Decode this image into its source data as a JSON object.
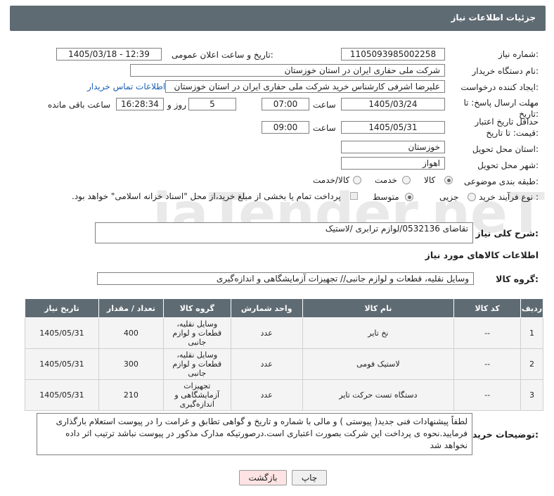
{
  "header": {
    "title": "جزئیات اطلاعات نیاز"
  },
  "fields": {
    "need_number_label": "شماره نیاز:",
    "need_number": "1105093985002258",
    "announce_label": "تاریخ و ساعت اعلان عمومی:",
    "announce_value": "1405/03/18 - 12:39",
    "buyer_org_label": "نام دستگاه خریدار:",
    "buyer_org": "شرکت ملی حفاری ایران در استان خوزستان",
    "requester_label": "ایجاد کننده درخواست:",
    "requester": "علیرضا اشرفی کارشناس خرید شرکت ملی حفاری ایران در استان خوزستان",
    "contact_link": "اطلاعات تماس خریدار",
    "deadline_label": "مهلت ارسال پاسخ: تا تاریخ:",
    "deadline_date": "1405/03/24",
    "time_label": "ساعت",
    "deadline_time": "07:00",
    "days_value": "5",
    "days_label": "روز و",
    "remaining_time": "16:28:34",
    "remaining_label": "ساعت باقی مانده",
    "validity_label": "حداقل تاریخ اعتبار قیمت: تا تاریخ:",
    "validity_date": "1405/05/31",
    "validity_time": "09:00",
    "province_label": "استان محل تحویل:",
    "province": "خوزستان",
    "city_label": "شهر محل تحویل:",
    "city": "اهواز",
    "category_label": "طبقه بندی موضوعی:",
    "category_options": [
      "کالا",
      "خدمت",
      "کالا/خدمت"
    ],
    "process_label": "نوع فرآیند خرید :",
    "process_options": [
      "جزیی",
      "متوسط"
    ],
    "payment_note": "پرداخت تمام یا بخشی از مبلغ خرید،از محل \"اسناد خزانه اسلامی\" خواهد بود."
  },
  "description": {
    "label": "شرح کلی نیاز:",
    "value": "تقاضای 0532136/لوازم ترابری /لاستیک"
  },
  "goods_section": {
    "title": "اطلاعات کالاهای مورد نیاز",
    "group_label": "گروه کالا:",
    "group_value": "وسایل نقلیه، قطعات و لوازم جانبی// تجهیزات آزمایشگاهی و اندازه‌گیری"
  },
  "table": {
    "headers": [
      "ردیف",
      "کد کالا",
      "نام کالا",
      "واحد شمارش",
      "گروه کالا",
      "تعداد / مقدار",
      "تاریخ نیاز"
    ],
    "rows": [
      {
        "row": "1",
        "code": "--",
        "name": "نخ تایر",
        "unit": "عدد",
        "group": "وسایل نقلیه، قطعات و لوازم جانبی",
        "qty": "400",
        "date": "1405/05/31"
      },
      {
        "row": "2",
        "code": "--",
        "name": "لاستیک فومی",
        "unit": "عدد",
        "group": "وسایل نقلیه، قطعات و لوازم جانبی",
        "qty": "300",
        "date": "1405/05/31"
      },
      {
        "row": "3",
        "code": "--",
        "name": "دستگاه تست حرکت تایر",
        "unit": "عدد",
        "group": "تجهیزات آزمایشگاهی و اندازه‌گیری",
        "qty": "210",
        "date": "1405/05/31"
      }
    ]
  },
  "notes": {
    "label": "توضیحات خریدار:",
    "value": "لطفاً پیشنهادات فنی جدید( پیوستی ) و مالی با شماره و تاریخ و گواهی تطابق و غرامت را در پیوست استعلام بارگذاری فرمایید.نحوه ی پرداخت این شرکت بصورت اعتباری است.درصورتیکه مدارک مذکور در پیوست نباشد ترتیب اثر داده نخواهد شد"
  },
  "buttons": {
    "print": "چاپ",
    "back": "بازگشت"
  },
  "watermark": {
    "text": "AriaTender.neT"
  },
  "colors": {
    "header_bg": "#5f6b73",
    "link": "#1a5fb4",
    "back_btn": "#fde3e3"
  }
}
